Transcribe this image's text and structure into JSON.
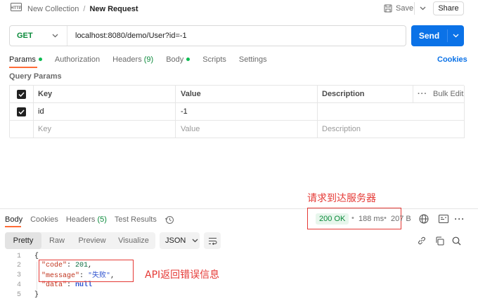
{
  "header": {
    "collection": "New Collection",
    "separator": "/",
    "request_name": "New Request",
    "save_label": "Save",
    "share_label": "Share"
  },
  "url_bar": {
    "method": "GET",
    "url": "localhost:8080/demo/User?id=-1",
    "send_label": "Send"
  },
  "request_tabs": {
    "params": "Params",
    "authorization": "Authorization",
    "headers": "Headers",
    "headers_count": "(9)",
    "body": "Body",
    "scripts": "Scripts",
    "settings": "Settings",
    "cookies": "Cookies"
  },
  "query_params": {
    "title": "Query Params",
    "columns": {
      "key": "Key",
      "value": "Value",
      "description": "Description",
      "bulk_edit": "Bulk Edit"
    },
    "row": {
      "key": "id",
      "value": "-1"
    },
    "placeholder": {
      "key": "Key",
      "value": "Value",
      "description": "Description"
    }
  },
  "annotations": {
    "status_note": "请求到达服务器",
    "error_note": "API返回错误信息",
    "color": "#e53935"
  },
  "response_tabs": {
    "body": "Body",
    "cookies": "Cookies",
    "headers": "Headers",
    "headers_count": "(5)",
    "test_results": "Test Results"
  },
  "response_status": {
    "status": "200 OK",
    "time": "188 ms",
    "size": "207 B"
  },
  "response_view": {
    "pretty": "Pretty",
    "raw": "Raw",
    "preview": "Preview",
    "visualize": "Visualize",
    "format": "JSON"
  },
  "response_body": {
    "lines": [
      {
        "num": "1",
        "text": "{"
      },
      {
        "num": "2",
        "key": "\"code\"",
        "sep": ": ",
        "val": "201",
        "end": ","
      },
      {
        "num": "3",
        "key": "\"message\"",
        "sep": ": ",
        "val": "\"失败\"",
        "end": ","
      },
      {
        "num": "4",
        "key": "\"data\"",
        "sep": ": ",
        "val": "null",
        "end": ""
      },
      {
        "num": "5",
        "text": "}"
      }
    ]
  },
  "colors": {
    "accent_blue": "#0b72e7",
    "tab_underline": "#ff6c37",
    "status_green": "#0a8a3a",
    "status_bg": "#e7f6ec",
    "json_key": "#c0341d",
    "json_number": "#0a6b3f",
    "json_string": "#3155d0"
  }
}
